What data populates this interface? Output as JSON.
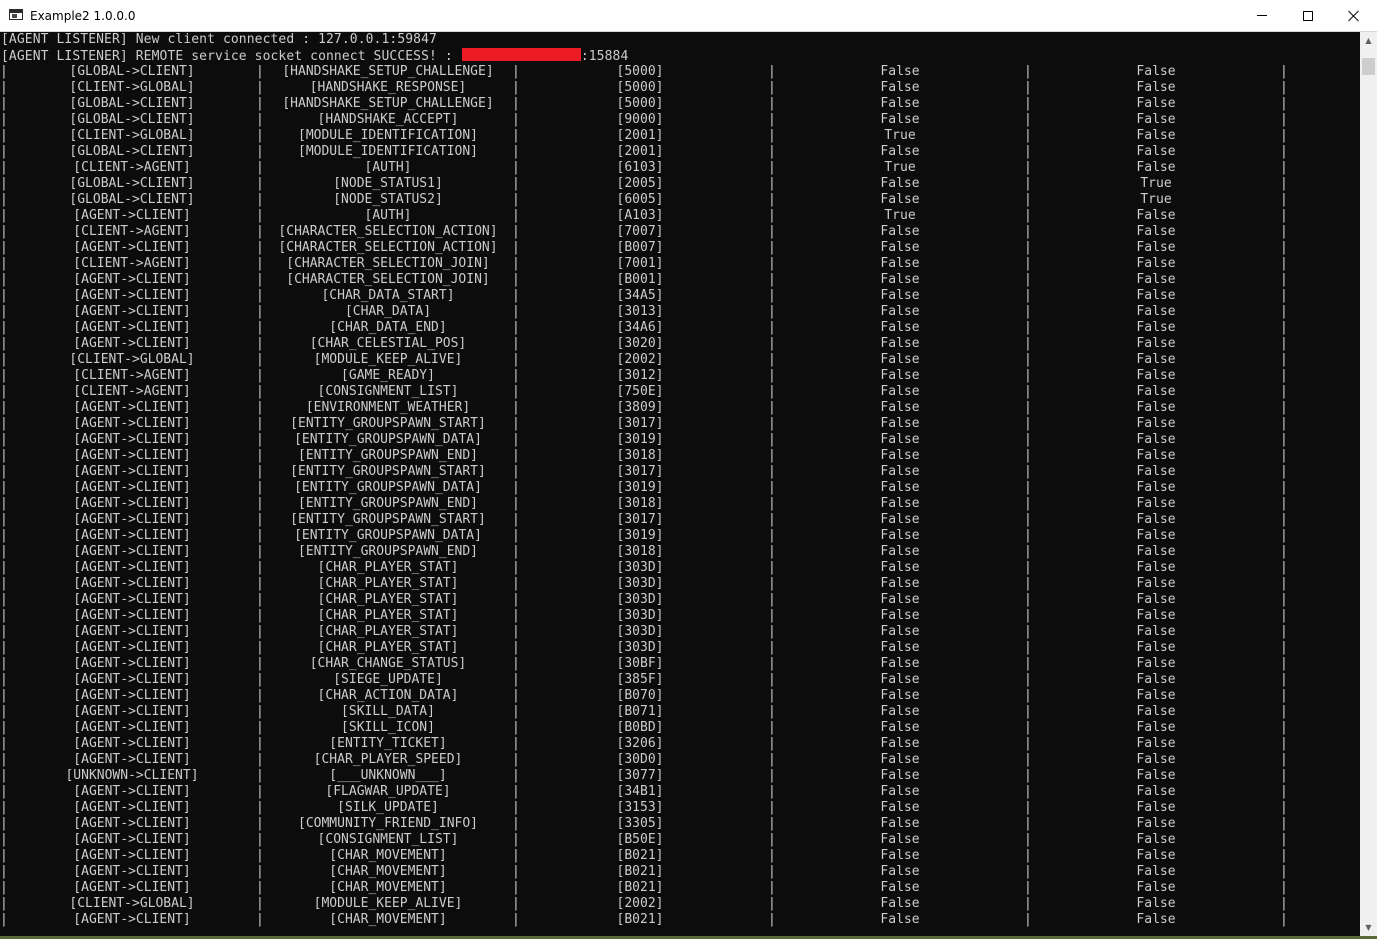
{
  "window": {
    "title": "Example2 1.0.0.0",
    "icon": "console-app-icon",
    "buttons": [
      "minimize-icon",
      "maximize-icon",
      "close-icon"
    ]
  },
  "console": {
    "colors": {
      "background": "#0c0c0c",
      "text": "#cccccc",
      "redaction": "#ed1c24"
    },
    "header_lines": [
      "[AGENT LISTENER] New client connected : 127.0.0.1:59847",
      "[AGENT LISTENER] REMOTE service socket connect SUCCESS! :"
    ],
    "header_port_suffix": ":15884",
    "rows": [
      [
        "[GLOBAL->CLIENT]",
        "[HANDSHAKE_SETUP_CHALLENGE]",
        "[5000]",
        "False",
        "False"
      ],
      [
        "[CLIENT->GLOBAL]",
        "[HANDSHAKE_RESPONSE]",
        "[5000]",
        "False",
        "False"
      ],
      [
        "[GLOBAL->CLIENT]",
        "[HANDSHAKE_SETUP_CHALLENGE]",
        "[5000]",
        "False",
        "False"
      ],
      [
        "[GLOBAL->CLIENT]",
        "[HANDSHAKE_ACCEPT]",
        "[9000]",
        "False",
        "False"
      ],
      [
        "[CLIENT->GLOBAL]",
        "[MODULE_IDENTIFICATION]",
        "[2001]",
        "True",
        "False"
      ],
      [
        "[GLOBAL->CLIENT]",
        "[MODULE_IDENTIFICATION]",
        "[2001]",
        "False",
        "False"
      ],
      [
        "[CLIENT->AGENT]",
        "[AUTH]",
        "[6103]",
        "True",
        "False"
      ],
      [
        "[GLOBAL->CLIENT]",
        "[NODE_STATUS1]",
        "[2005]",
        "False",
        "True"
      ],
      [
        "[GLOBAL->CLIENT]",
        "[NODE_STATUS2]",
        "[6005]",
        "False",
        "True"
      ],
      [
        "[AGENT->CLIENT]",
        "[AUTH]",
        "[A103]",
        "True",
        "False"
      ],
      [
        "[CLIENT->AGENT]",
        "[CHARACTER_SELECTION_ACTION]",
        "[7007]",
        "False",
        "False"
      ],
      [
        "[AGENT->CLIENT]",
        "[CHARACTER_SELECTION_ACTION]",
        "[B007]",
        "False",
        "False"
      ],
      [
        "[CLIENT->AGENT]",
        "[CHARACTER_SELECTION_JOIN]",
        "[7001]",
        "False",
        "False"
      ],
      [
        "[AGENT->CLIENT]",
        "[CHARACTER_SELECTION_JOIN]",
        "[B001]",
        "False",
        "False"
      ],
      [
        "[AGENT->CLIENT]",
        "[CHAR_DATA_START]",
        "[34A5]",
        "False",
        "False"
      ],
      [
        "[AGENT->CLIENT]",
        "[CHAR_DATA]",
        "[3013]",
        "False",
        "False"
      ],
      [
        "[AGENT->CLIENT]",
        "[CHAR_DATA_END]",
        "[34A6]",
        "False",
        "False"
      ],
      [
        "[AGENT->CLIENT]",
        "[CHAR_CELESTIAL_POS]",
        "[3020]",
        "False",
        "False"
      ],
      [
        "[CLIENT->GLOBAL]",
        "[MODULE_KEEP_ALIVE]",
        "[2002]",
        "False",
        "False"
      ],
      [
        "[CLIENT->AGENT]",
        "[GAME_READY]",
        "[3012]",
        "False",
        "False"
      ],
      [
        "[CLIENT->AGENT]",
        "[CONSIGNMENT_LIST]",
        "[750E]",
        "False",
        "False"
      ],
      [
        "[AGENT->CLIENT]",
        "[ENVIRONMENT_WEATHER]",
        "[3809]",
        "False",
        "False"
      ],
      [
        "[AGENT->CLIENT]",
        "[ENTITY_GROUPSPAWN_START]",
        "[3017]",
        "False",
        "False"
      ],
      [
        "[AGENT->CLIENT]",
        "[ENTITY_GROUPSPAWN_DATA]",
        "[3019]",
        "False",
        "False"
      ],
      [
        "[AGENT->CLIENT]",
        "[ENTITY_GROUPSPAWN_END]",
        "[3018]",
        "False",
        "False"
      ],
      [
        "[AGENT->CLIENT]",
        "[ENTITY_GROUPSPAWN_START]",
        "[3017]",
        "False",
        "False"
      ],
      [
        "[AGENT->CLIENT]",
        "[ENTITY_GROUPSPAWN_DATA]",
        "[3019]",
        "False",
        "False"
      ],
      [
        "[AGENT->CLIENT]",
        "[ENTITY_GROUPSPAWN_END]",
        "[3018]",
        "False",
        "False"
      ],
      [
        "[AGENT->CLIENT]",
        "[ENTITY_GROUPSPAWN_START]",
        "[3017]",
        "False",
        "False"
      ],
      [
        "[AGENT->CLIENT]",
        "[ENTITY_GROUPSPAWN_DATA]",
        "[3019]",
        "False",
        "False"
      ],
      [
        "[AGENT->CLIENT]",
        "[ENTITY_GROUPSPAWN_END]",
        "[3018]",
        "False",
        "False"
      ],
      [
        "[AGENT->CLIENT]",
        "[CHAR_PLAYER_STAT]",
        "[303D]",
        "False",
        "False"
      ],
      [
        "[AGENT->CLIENT]",
        "[CHAR_PLAYER_STAT]",
        "[303D]",
        "False",
        "False"
      ],
      [
        "[AGENT->CLIENT]",
        "[CHAR_PLAYER_STAT]",
        "[303D]",
        "False",
        "False"
      ],
      [
        "[AGENT->CLIENT]",
        "[CHAR_PLAYER_STAT]",
        "[303D]",
        "False",
        "False"
      ],
      [
        "[AGENT->CLIENT]",
        "[CHAR_PLAYER_STAT]",
        "[303D]",
        "False",
        "False"
      ],
      [
        "[AGENT->CLIENT]",
        "[CHAR_PLAYER_STAT]",
        "[303D]",
        "False",
        "False"
      ],
      [
        "[AGENT->CLIENT]",
        "[CHAR_CHANGE_STATUS]",
        "[30BF]",
        "False",
        "False"
      ],
      [
        "[AGENT->CLIENT]",
        "[SIEGE_UPDATE]",
        "[385F]",
        "False",
        "False"
      ],
      [
        "[AGENT->CLIENT]",
        "[CHAR_ACTION_DATA]",
        "[B070]",
        "False",
        "False"
      ],
      [
        "[AGENT->CLIENT]",
        "[SKILL_DATA]",
        "[B071]",
        "False",
        "False"
      ],
      [
        "[AGENT->CLIENT]",
        "[SKILL_ICON]",
        "[B0BD]",
        "False",
        "False"
      ],
      [
        "[AGENT->CLIENT]",
        "[ENTITY_TICKET]",
        "[3206]",
        "False",
        "False"
      ],
      [
        "[AGENT->CLIENT]",
        "[CHAR_PLAYER_SPEED]",
        "[30D0]",
        "False",
        "False"
      ],
      [
        "[UNKNOWN->CLIENT]",
        "[___UNKNOWN___]",
        "[3077]",
        "False",
        "False"
      ],
      [
        "[AGENT->CLIENT]",
        "[FLAGWAR_UPDATE]",
        "[34B1]",
        "False",
        "False"
      ],
      [
        "[AGENT->CLIENT]",
        "[SILK_UPDATE]",
        "[3153]",
        "False",
        "False"
      ],
      [
        "[AGENT->CLIENT]",
        "[COMMUNITY_FRIEND_INFO]",
        "[3305]",
        "False",
        "False"
      ],
      [
        "[AGENT->CLIENT]",
        "[CONSIGNMENT_LIST]",
        "[B50E]",
        "False",
        "False"
      ],
      [
        "[AGENT->CLIENT]",
        "[CHAR_MOVEMENT]",
        "[B021]",
        "False",
        "False"
      ],
      [
        "[AGENT->CLIENT]",
        "[CHAR_MOVEMENT]",
        "[B021]",
        "False",
        "False"
      ],
      [
        "[AGENT->CLIENT]",
        "[CHAR_MOVEMENT]",
        "[B021]",
        "False",
        "False"
      ],
      [
        "[CLIENT->GLOBAL]",
        "[MODULE_KEEP_ALIVE]",
        "[2002]",
        "False",
        "False"
      ],
      [
        "[AGENT->CLIENT]",
        "[CHAR_MOVEMENT]",
        "[B021]",
        "False",
        "False"
      ]
    ]
  },
  "scrollbar": {
    "up_arrow": "▲",
    "down_arrow": "▼"
  }
}
